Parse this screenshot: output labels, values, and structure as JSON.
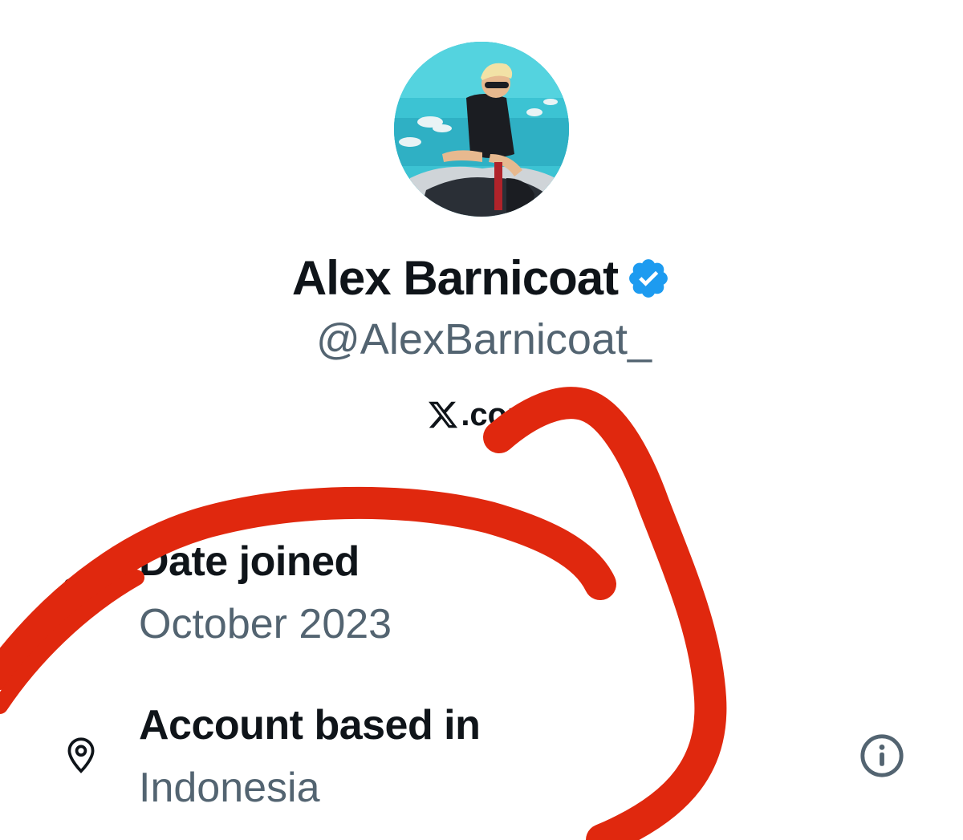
{
  "profile": {
    "display_name": "Alex Barnicoat",
    "handle": "@AlexBarnicoat_",
    "verified": true,
    "avatar_icon": "profile-photo",
    "source": {
      "icon": "x-logo-icon",
      "label": ".com"
    }
  },
  "about": {
    "date_joined": {
      "icon": "calendar-icon",
      "label": "Date joined",
      "value": "October 2023"
    },
    "account_based_in": {
      "icon": "location-pin-icon",
      "label": "Account based in",
      "value": "Indonesia",
      "info_icon": "info-icon"
    }
  },
  "colors": {
    "primary_text": "#0f1419",
    "secondary_text": "#536471",
    "verified_blue": "#1d9bf0",
    "annotation_red": "#e0280e"
  }
}
